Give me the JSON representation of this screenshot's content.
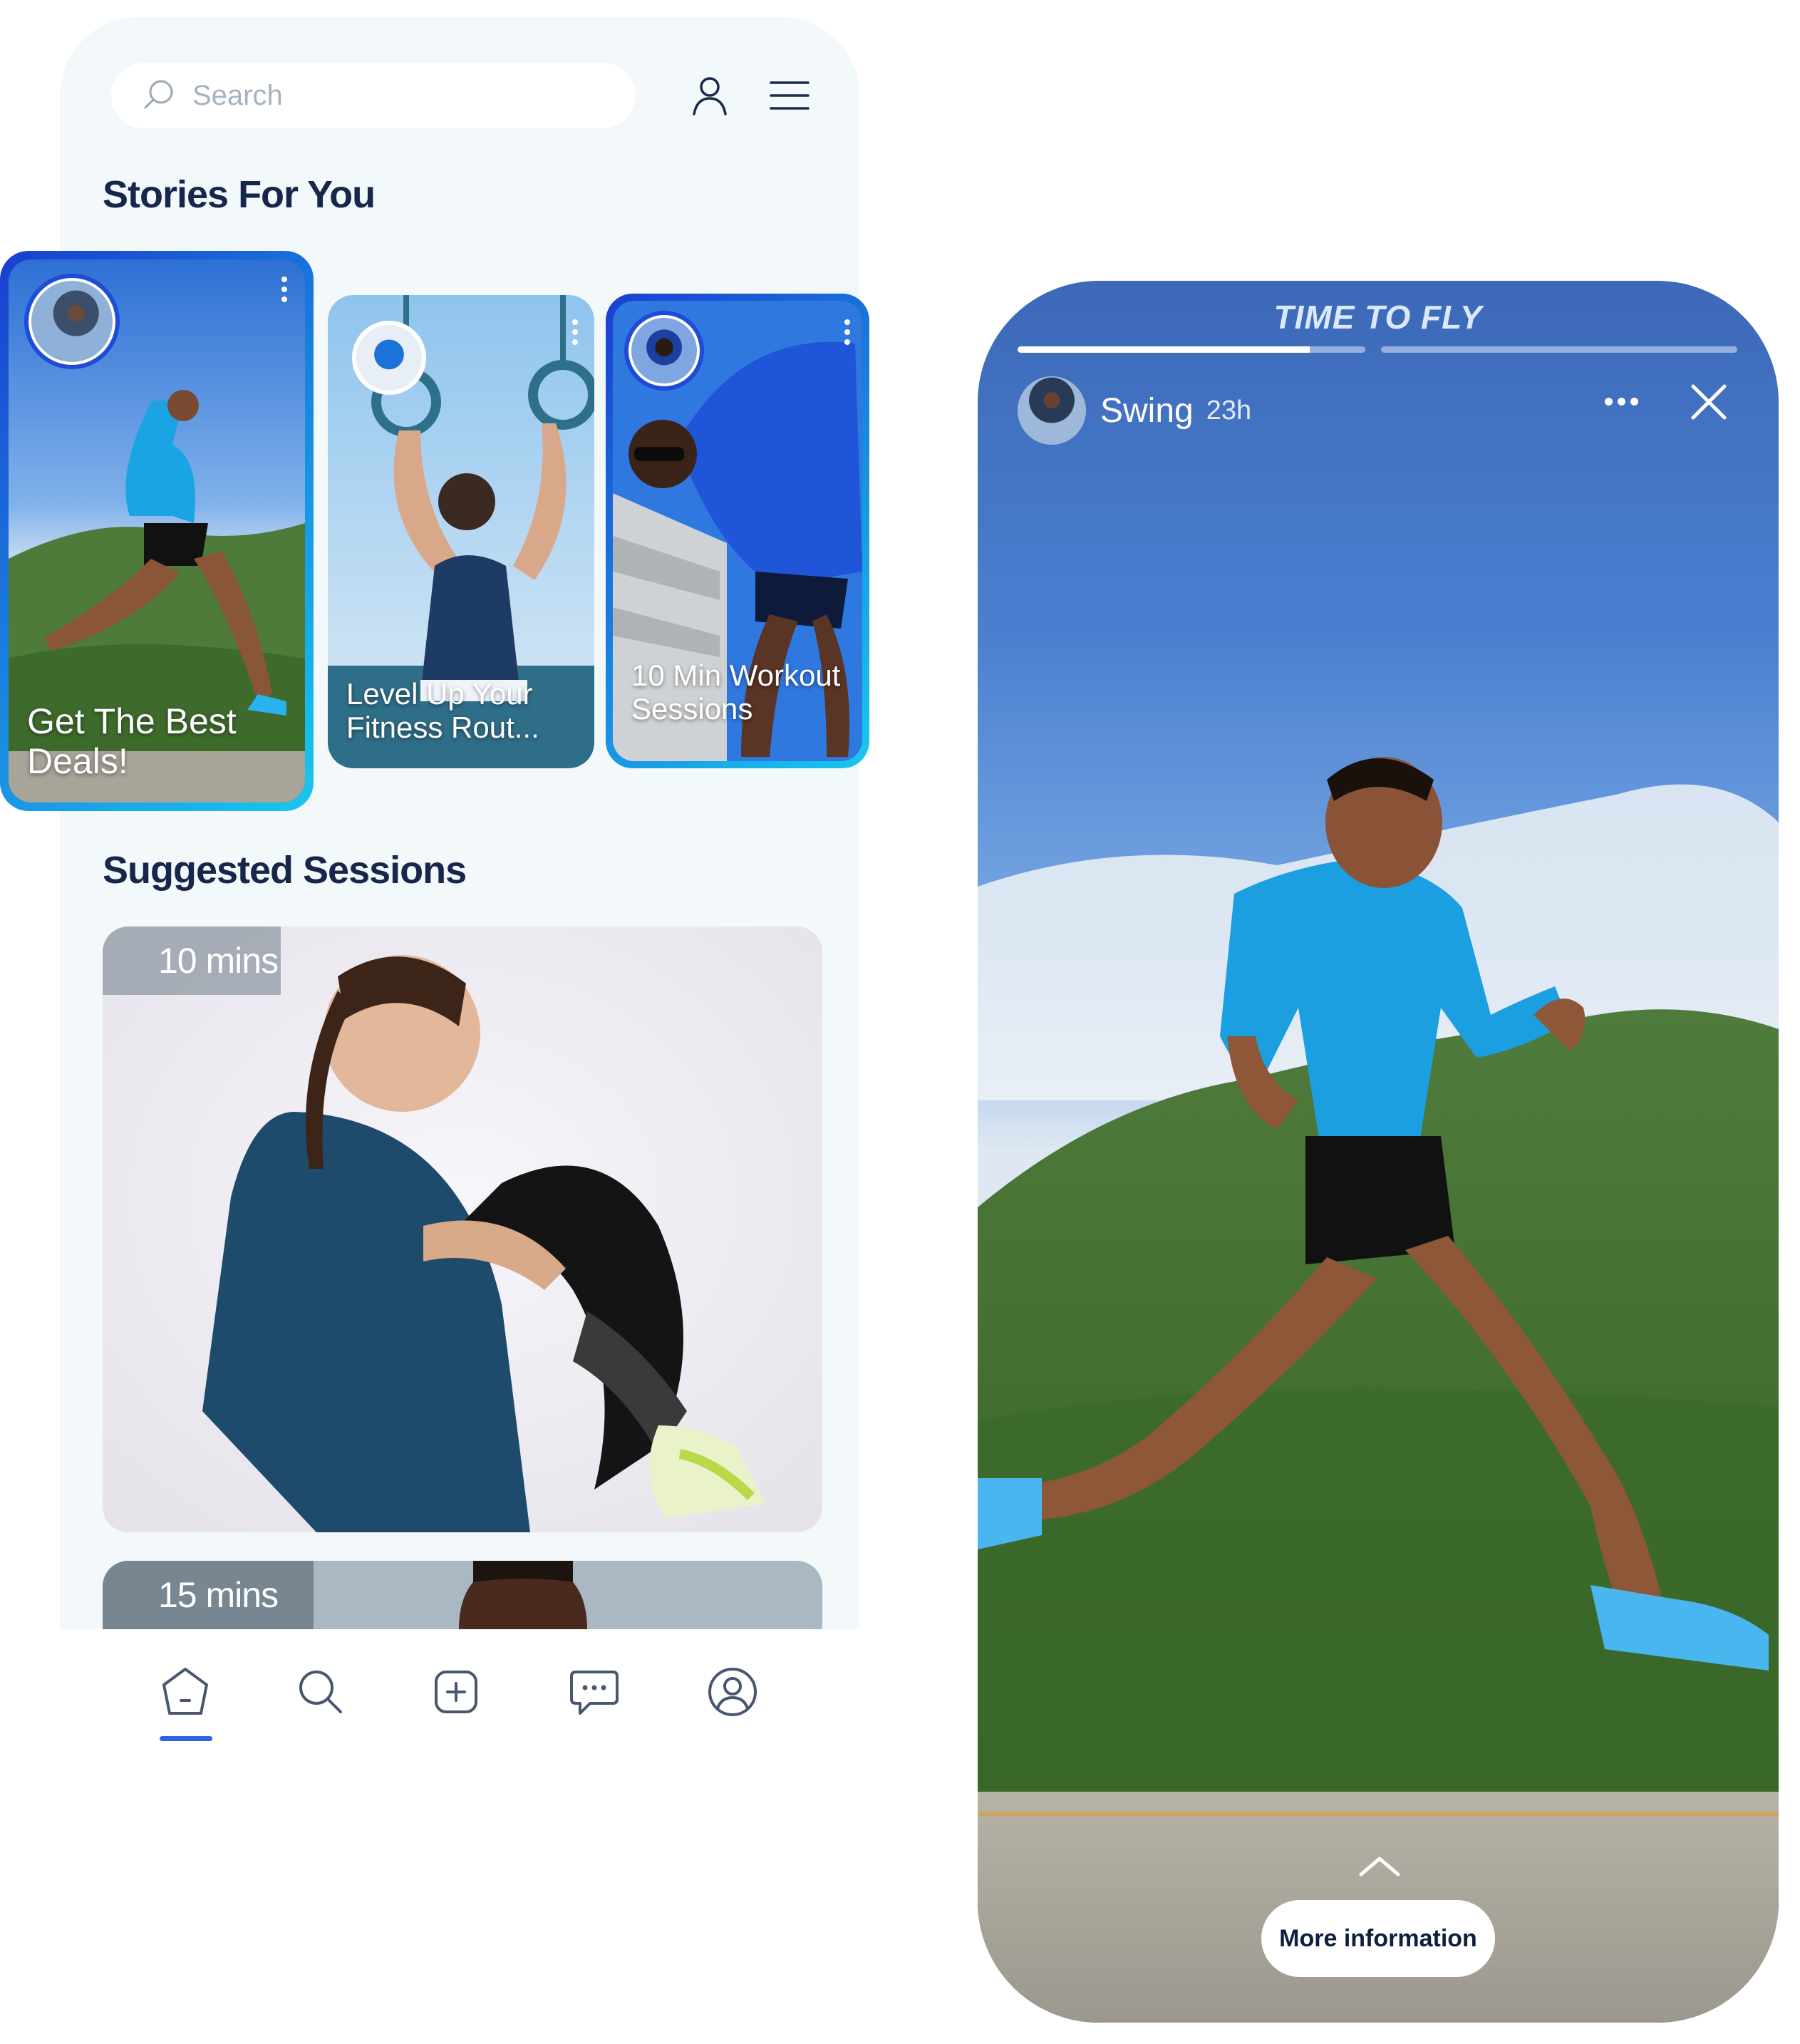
{
  "search": {
    "placeholder": "Search"
  },
  "header": {
    "profile_icon": "user-icon",
    "menu_icon": "hamburger-menu-icon"
  },
  "stories": {
    "title": "Stories For You",
    "items": [
      {
        "caption": "Get The Best Deals!",
        "highlighted": true
      },
      {
        "caption": "Level Up Your Fitness Rout...",
        "highlighted": false
      },
      {
        "caption": "10 Min Workout Sessions",
        "highlighted": true
      }
    ]
  },
  "sessions": {
    "title": "Suggested Sessions",
    "items": [
      {
        "duration": "10 mins"
      },
      {
        "duration": "15 mins"
      }
    ]
  },
  "bottom_nav": {
    "items": [
      "home-icon",
      "search-icon",
      "add-icon",
      "chat-icon",
      "profile-icon"
    ],
    "active_index": 0
  },
  "viewer": {
    "brand": "TIME TO FLY",
    "user": "Swing",
    "time": "23h",
    "progress": [
      0.84,
      0.0
    ],
    "more_info": "More information"
  },
  "colors": {
    "accent": "#2a64e8",
    "ring_outer": "#1e4bd8",
    "ring_glow": "#1ad0f0",
    "title": "#17264a"
  }
}
